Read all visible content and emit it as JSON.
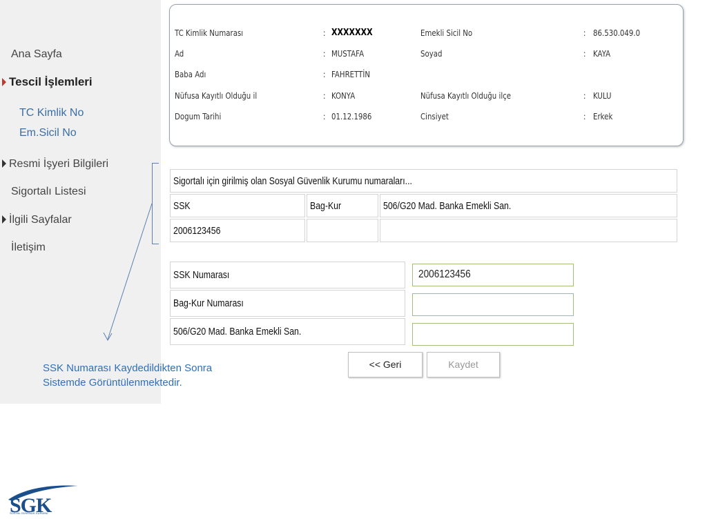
{
  "sidebar": {
    "items": [
      {
        "label": "Ana Sayfa"
      },
      {
        "label": "Tescil İşlemleri"
      },
      {
        "label": "TC Kimlik No"
      },
      {
        "label": "Em.Sicil No"
      },
      {
        "label": "Resmi İşyeri Bilgileri"
      },
      {
        "label": "Sigortalı Listesi"
      },
      {
        "label": "İlgili Sayfalar"
      },
      {
        "label": "İletişim"
      }
    ]
  },
  "info": {
    "separator": ":",
    "rows": [
      {
        "l1": "TC Kimlik Numarası",
        "v1": "XXXXXXX",
        "l2": "Emekli Sicil No",
        "v2": "86.530.049.0"
      },
      {
        "l1": "Ad",
        "v1": "MUSTAFA",
        "l2": "Soyad",
        "v2": "KAYA"
      },
      {
        "l1": "Baba Adı",
        "v1": "FAHRETTİN",
        "l2": "",
        "v2": ""
      },
      {
        "l1": "Nüfusa Kayıtlı Olduğu il",
        "v1": "KONYA",
        "l2": "Nüfusa Kayıtlı Olduğu ilçe",
        "v2": "KULU"
      },
      {
        "l1": "Dogum Tarihi",
        "v1": "01.12.1986",
        "l2": "Cinsiyet",
        "v2": "Erkek"
      }
    ]
  },
  "ssk_table": {
    "title": "Sigortalı için girilmiş olan Sosyal Güvenlik Kurumu numaraları...",
    "headers": [
      "SSK",
      "Bag-Kur",
      "506/G20 Mad. Banka Emekli San."
    ],
    "row": [
      "2006123456",
      "",
      ""
    ]
  },
  "form": {
    "fields": [
      {
        "label": "SSK Numarası",
        "value": "2006123456"
      },
      {
        "label": "Bag-Kur Numarası",
        "value": ""
      },
      {
        "label": "506/G20 Mad. Banka Emekli San.",
        "value": ""
      }
    ],
    "back_label": "<< Geri",
    "save_label": "Kaydet"
  },
  "caption": {
    "line1": "SSK Numarası Kaydedildikten Sonra",
    "line2": "Sistemde Görüntülenmektedir."
  },
  "logo": {
    "text": "SGK",
    "subtitle": "SOSYAL GÜVENLİK KURUMU"
  },
  "colors": {
    "accent": "#c0392b",
    "link": "#3a6ea5",
    "caption": "#2f6fb8",
    "field_border": "#9fbf7f",
    "brand": "#1b4f8c"
  }
}
